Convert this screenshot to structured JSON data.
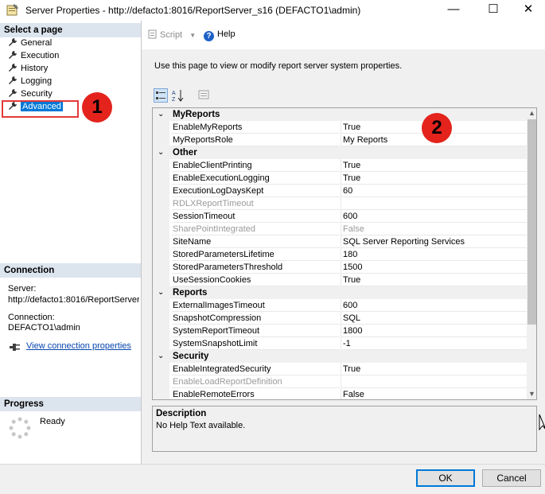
{
  "window": {
    "title": "Server Properties - http://defacto1:8016/ReportServer_s16 (DEFACTO1\\admin)",
    "minimize_glyph": "—",
    "maximize_glyph": "☐",
    "close_glyph": "✕"
  },
  "left_panel": {
    "select_page_heading": "Select a page",
    "pages": [
      {
        "label": "General",
        "icon": "wrench-icon"
      },
      {
        "label": "Execution",
        "icon": "wrench-icon"
      },
      {
        "label": "History",
        "icon": "wrench-icon"
      },
      {
        "label": "Logging",
        "icon": "wrench-icon"
      },
      {
        "label": "Security",
        "icon": "wrench-icon"
      },
      {
        "label": "Advanced",
        "icon": "wrench-icon",
        "selected": true
      }
    ],
    "connection_heading": "Connection",
    "server_label": "Server:",
    "server_value": "http://defacto1:8016/ReportServer",
    "connection_label": "Connection:",
    "connection_value": "DEFACTO1\\admin",
    "view_connection_link": "View connection properties",
    "progress_heading": "Progress",
    "progress_status": "Ready"
  },
  "annotations": {
    "badge_1": "1",
    "badge_2": "2",
    "badge_color": "#e3231c"
  },
  "toolbar": {
    "script_label": "Script",
    "help_label": "Help"
  },
  "main": {
    "description": "Use this page to view or modify report server system properties."
  },
  "property_grid": {
    "categories": [
      {
        "name": "MyReports",
        "properties": [
          {
            "name": "EnableMyReports",
            "value": "True",
            "enabled": true
          },
          {
            "name": "MyReportsRole",
            "value": "My Reports",
            "enabled": true
          }
        ]
      },
      {
        "name": "Other",
        "properties": [
          {
            "name": "EnableClientPrinting",
            "value": "True",
            "enabled": true
          },
          {
            "name": "EnableExecutionLogging",
            "value": "True",
            "enabled": true
          },
          {
            "name": "ExecutionLogDaysKept",
            "value": "60",
            "enabled": true
          },
          {
            "name": "RDLXReportTimeout",
            "value": "",
            "enabled": false
          },
          {
            "name": "SessionTimeout",
            "value": "600",
            "enabled": true
          },
          {
            "name": "SharePointIntegrated",
            "value": "False",
            "enabled": false
          },
          {
            "name": "SiteName",
            "value": "SQL Server Reporting Services",
            "enabled": true
          },
          {
            "name": "StoredParametersLifetime",
            "value": "180",
            "enabled": true
          },
          {
            "name": "StoredParametersThreshold",
            "value": "1500",
            "enabled": true
          },
          {
            "name": "UseSessionCookies",
            "value": "True",
            "enabled": true
          }
        ]
      },
      {
        "name": "Reports",
        "properties": [
          {
            "name": "ExternalImagesTimeout",
            "value": "600",
            "enabled": true
          },
          {
            "name": "SnapshotCompression",
            "value": "SQL",
            "enabled": true
          },
          {
            "name": "SystemReportTimeout",
            "value": "1800",
            "enabled": true
          },
          {
            "name": "SystemSnapshotLimit",
            "value": "-1",
            "enabled": true
          }
        ]
      },
      {
        "name": "Security",
        "properties": [
          {
            "name": "EnableIntegratedSecurity",
            "value": "True",
            "enabled": true
          },
          {
            "name": "EnableLoadReportDefinition",
            "value": "",
            "enabled": false
          },
          {
            "name": "EnableRemoteErrors",
            "value": "False",
            "enabled": true
          }
        ]
      }
    ]
  },
  "description_panel": {
    "title": "Description",
    "text": "No Help Text available."
  },
  "buttons": {
    "ok": "OK",
    "cancel": "Cancel"
  }
}
